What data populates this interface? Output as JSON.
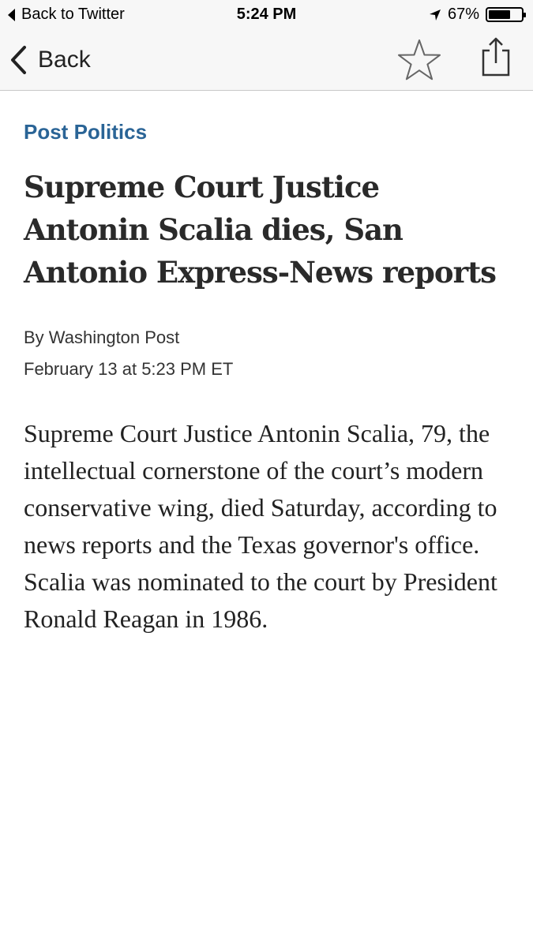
{
  "status_bar": {
    "back_label": "Back to Twitter",
    "time": "5:24 PM",
    "battery_percent": "67%",
    "battery_level": 0.67,
    "location_icon": "location-arrow-icon"
  },
  "nav": {
    "back_label": "Back",
    "back_icon": "chevron-left-icon",
    "star_icon": "star-icon",
    "share_icon": "share-icon"
  },
  "article": {
    "section": "Post Politics",
    "headline": "Supreme Court Justice Antonin Scalia dies, San Antonio Express-News reports",
    "byline": "By Washington Post",
    "dateline": "February 13 at 5:23 PM ET",
    "body": "Supreme Court Justice Antonin Scalia, 79, the intellectual cornerstone of the court’s modern conservative wing, died Saturday, according to news reports and the Texas governor's office. Scalia was nominated to the court by President Ronald Reagan in 1986."
  },
  "colors": {
    "section_accent": "#2a6496",
    "bar_background": "#f7f7f7"
  }
}
